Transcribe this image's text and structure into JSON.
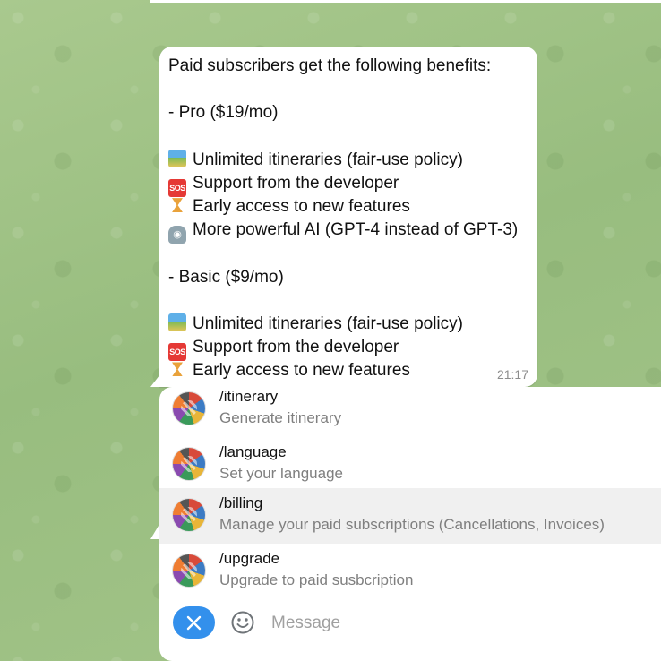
{
  "message": {
    "lines": [
      {
        "text": "Paid subscribers get the following benefits:"
      },
      {
        "text": ""
      },
      {
        "text": "- Pro ($19/mo)"
      },
      {
        "text": ""
      },
      {
        "text": "Unlimited itineraries (fair-use policy)",
        "icon": "world-map-icon"
      },
      {
        "text": "Support from the developer",
        "icon": "sos-icon"
      },
      {
        "text": "Early access to new features",
        "icon": "hourglass-icon"
      },
      {
        "text": "More powerful AI (GPT-4 instead of GPT-3)",
        "icon": "robot-icon"
      },
      {
        "text": ""
      },
      {
        "text": "- Basic ($9/mo)"
      },
      {
        "text": ""
      },
      {
        "text": "Unlimited itineraries (fair-use policy)",
        "icon": "world-map-icon"
      },
      {
        "text": "Support from the developer",
        "icon": "sos-icon"
      },
      {
        "text": "Early access to new features",
        "icon": "hourglass-icon"
      }
    ],
    "time": "21:17"
  },
  "commands": [
    {
      "name": "/itinerary",
      "description": "Generate itinerary"
    },
    {
      "name": "/language",
      "description": "Set your language"
    },
    {
      "name": "/billing",
      "description": "Manage your paid subscriptions (Cancellations, Invoices)",
      "highlighted": true
    },
    {
      "name": "/upgrade",
      "description": "Upgrade to paid susbcription"
    }
  ],
  "composer": {
    "placeholder": "Message",
    "value": ""
  },
  "colors": {
    "accent": "#3390ec",
    "chat_background": "#a4c58a",
    "highlight_row": "#f0f0f0"
  }
}
